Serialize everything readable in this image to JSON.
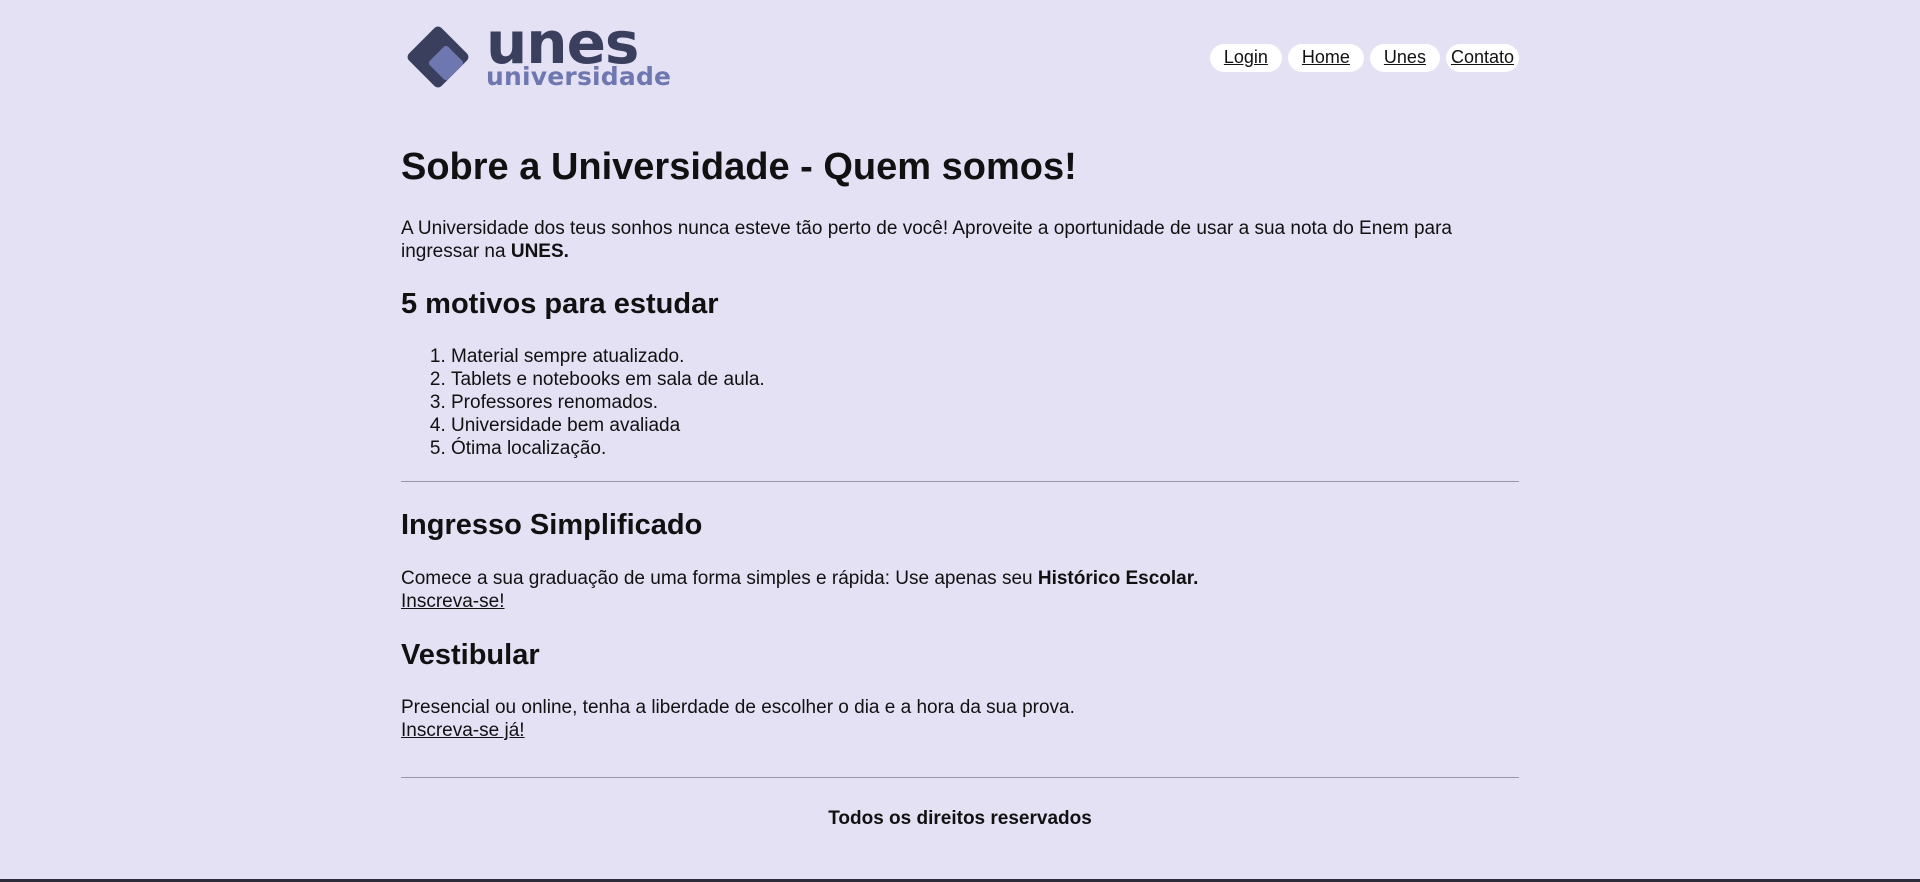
{
  "logo": {
    "word": "unes",
    "sub": "universidade",
    "colors": {
      "dark": "#3a3f5e",
      "light": "#6f77b0"
    }
  },
  "nav": {
    "items": [
      "Login",
      "Home",
      "Unes",
      "Contato"
    ]
  },
  "main": {
    "title": "Sobre a Universidade - Quem somos!",
    "intro_text": "A Universidade dos teus sonhos nunca esteve tão perto de você! Aproveite a oportunidade de usar a sua nota do Enem para ingressar na ",
    "intro_bold": "UNES.",
    "reasons_heading": "5 motivos para estudar",
    "reasons": [
      "Material sempre atualizado.",
      "Tablets e notebooks em sala de aula.",
      "Professores renomados.",
      "Universidade bem avaliada",
      "Ótima localização."
    ],
    "ingresso": {
      "heading": "Ingresso Simplificado",
      "text": "Comece a sua graduação de uma forma simples e rápida: Use apenas seu ",
      "bold": "Histórico Escolar.",
      "link": "Inscreva-se!"
    },
    "vestibular": {
      "heading": "Vestibular",
      "text": "Presencial ou online, tenha a liberdade de escolher o dia e a hora da sua prova.",
      "link": "Inscreva-se já!"
    }
  },
  "footer": {
    "text": "Todos os direitos reservados"
  },
  "colors": {
    "background": "#e4e1f5",
    "nav_pill": "#ffffff"
  }
}
